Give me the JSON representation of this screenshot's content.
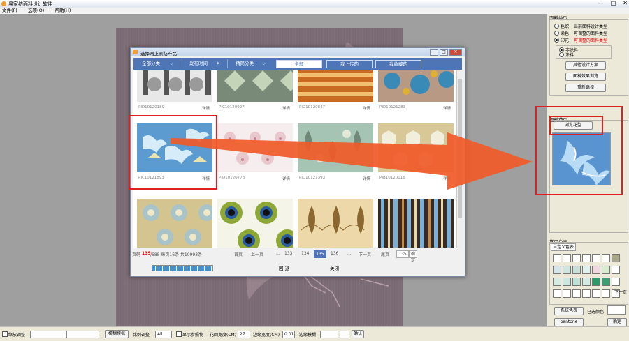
{
  "app": {
    "title": "易家纺面料设计软件",
    "win_controls": [
      "—",
      "□",
      "✕"
    ],
    "menu": [
      "文件(F)",
      "选项(O)",
      "帮助(H)"
    ]
  },
  "dialog": {
    "title": "选择网上家纺产品",
    "controls": [
      "–",
      "□",
      "✕"
    ],
    "filters": {
      "all_category": "全部分类",
      "publish_time": "发布时间",
      "featured": "精简分类",
      "btn_all": "全部",
      "btn_uploaded": "我上传的",
      "btn_favorites": "我收藏的"
    },
    "detail_label": "详情",
    "items": [
      {
        "pid": "PID10120189"
      },
      {
        "pid": "PIC10120927"
      },
      {
        "pid": "PID10120847"
      },
      {
        "pid": "PID10121283"
      },
      {
        "pid": "PIC10121893"
      },
      {
        "pid": "PID10120778"
      },
      {
        "pid": "PID10121393"
      },
      {
        "pid": "PIB10120016"
      },
      {
        "pid": ""
      },
      {
        "pid": ""
      },
      {
        "pid": ""
      },
      {
        "pid": ""
      }
    ],
    "pager": {
      "prefix": "页码",
      "current": "135",
      "info": "/688 每页16条 共10993条",
      "first": "首页",
      "prev": "上一页",
      "pages": [
        "133",
        "134",
        "135",
        "136"
      ],
      "dots": "...",
      "next": "下一页",
      "last": "尾页",
      "goto_value": "135",
      "go": "确定"
    },
    "btn_back": "回 退",
    "btn_close": "关闭"
  },
  "panel": {
    "fabric_type_title": "面料类型",
    "fabric_types": [
      "色织",
      "染色",
      "印花"
    ],
    "fabric_type_desc": [
      "当前面料设计类型",
      "可调整的面料类型",
      "可调整的面料类型"
    ],
    "print_options": [
      "非涂料",
      "涂料"
    ],
    "btn_other_scheme": "其他设计方案",
    "btn_preview_effect": "面料效果浏览",
    "btn_reselect": "重新选择",
    "pattern_title": "面料花型",
    "btn_browse_pattern": "浏览花型",
    "common_colors_title": "常用色表",
    "custom_colors_tab": "自定义色表",
    "next_page": "下一页",
    "btn_system_colors": "系统色表",
    "selected_color_label": "已选颜色",
    "btn_pantone": "pantone",
    "btn_confirm": "确定",
    "swatches": [
      "#ffffff",
      "#ffffff",
      "#ffffff",
      "#ffffff",
      "#ffffff",
      "#ffffff",
      "#a9a88a",
      "#d4e6ea",
      "#cfe5e0",
      "#c8e0d8",
      "#dff0ee",
      "#f0d8e0",
      "#d8ecd0",
      "#ffffff",
      "#d7ece0",
      "#cce6e0",
      "#bfe0d4",
      "#d2ebe4",
      "#2e9a6a",
      "#3aa074",
      "#ffffff",
      "#ffffff",
      "#ffffff",
      "#ffffff",
      "#ffffff",
      "#ffffff",
      "#ffffff",
      "#ffffff"
    ]
  },
  "bottom": {
    "zoom_label": "缩放调整",
    "btn_blur": "模糊模拟",
    "ratio_label": "比例调整",
    "ratio_value": "All",
    "show_reference": "显示参照物",
    "pattern_width_label": "花回宽度(CM)",
    "pattern_width_value": "27",
    "edge_width_label": "边缘宽度(CM)",
    "edge_width_value": "0.01",
    "edge_blur_label": "边缘模糊",
    "btn_ok": "确认"
  }
}
